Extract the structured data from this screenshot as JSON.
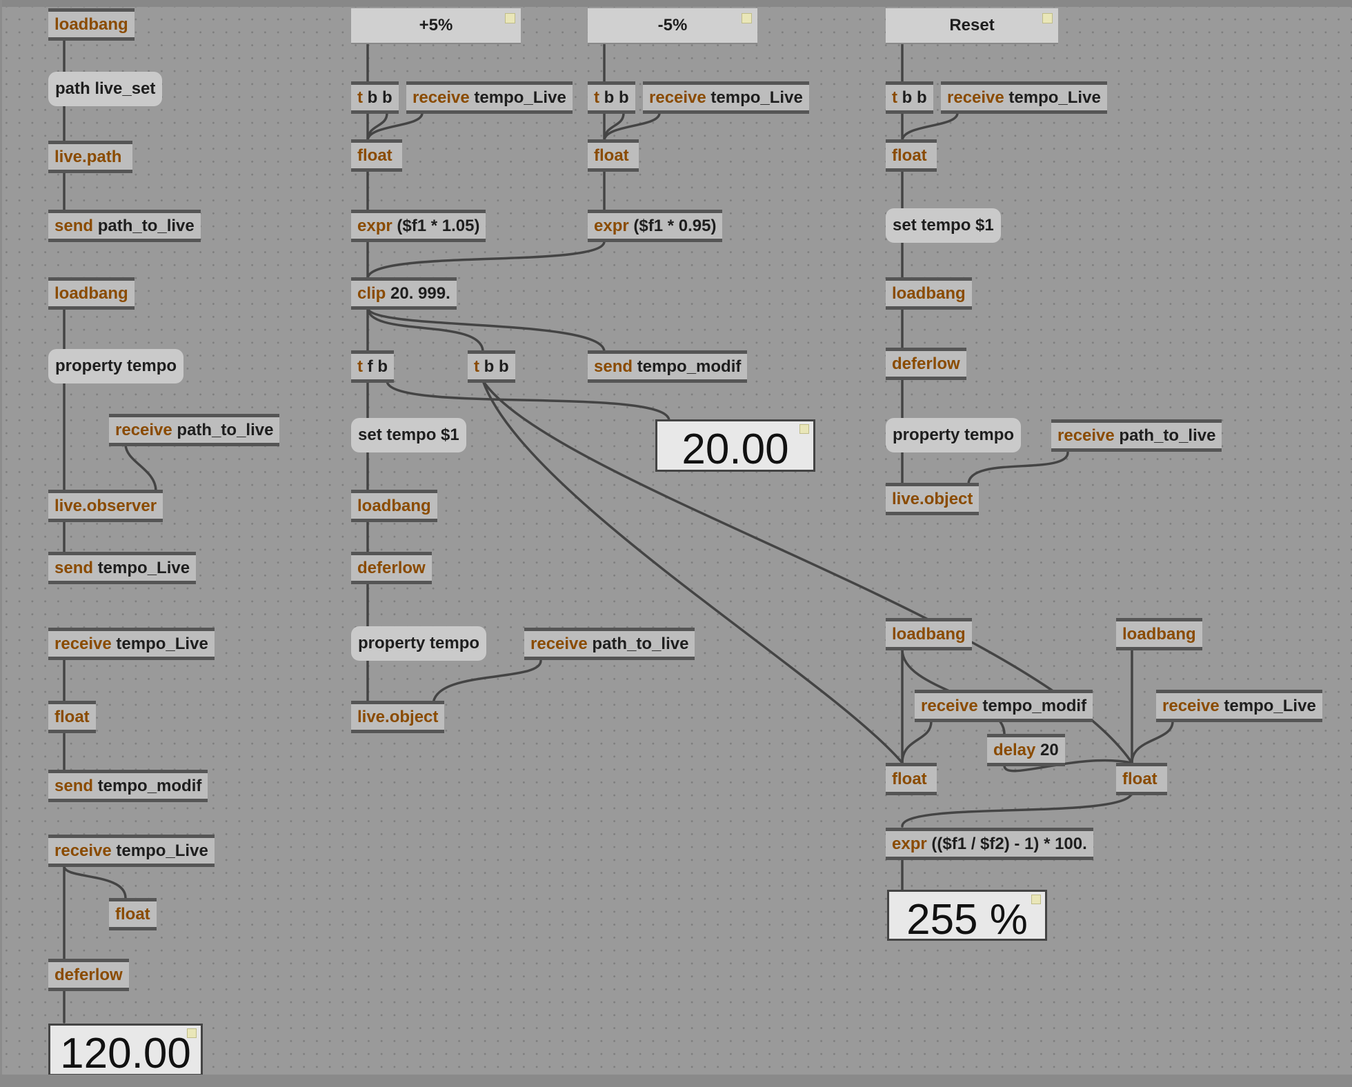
{
  "buttons": {
    "plus": "+5%",
    "minus": "-5%",
    "reset": "Reset"
  },
  "displays": {
    "tempo_mod": "20.00",
    "tempo_main": "120.00",
    "percent": "255 %"
  },
  "messages": {
    "path_live_set": "path live_set",
    "property_tempo_a": "property tempo",
    "set_tempo_mid": "set tempo $1",
    "property_tempo_mid": "property tempo",
    "set_tempo_right": "set tempo $1",
    "property_tempo_right": "property tempo"
  },
  "objects": {
    "loadbang_1": {
      "cls": "loadbang",
      "args": ""
    },
    "live_path": {
      "cls": "live.path",
      "args": ""
    },
    "send_path": {
      "cls": "send",
      "args": "path_to_live"
    },
    "loadbang_2": {
      "cls": "loadbang",
      "args": ""
    },
    "recv_path_left": {
      "cls": "receive",
      "args": "path_to_live"
    },
    "live_observer": {
      "cls": "live.observer",
      "args": ""
    },
    "send_tempo_live": {
      "cls": "send",
      "args": "tempo_Live"
    },
    "recv_tempo_live_a": {
      "cls": "receive",
      "args": "tempo_Live"
    },
    "float_left_a": {
      "cls": "float",
      "args": ""
    },
    "send_tempo_modif_left": {
      "cls": "send",
      "args": "tempo_modif"
    },
    "recv_tempo_live_b": {
      "cls": "receive",
      "args": "tempo_Live"
    },
    "float_left_b": {
      "cls": "float",
      "args": ""
    },
    "deferlow_left": {
      "cls": "deferlow",
      "args": ""
    },
    "tbb_plus": {
      "cls": "t",
      "args": "b b"
    },
    "recv_tempo_plus": {
      "cls": "receive",
      "args": "tempo_Live"
    },
    "float_plus": {
      "cls": "float",
      "args": ""
    },
    "expr_plus": {
      "cls": "expr",
      "args": "($f1 * 1.05)"
    },
    "tbb_minus": {
      "cls": "t",
      "args": "b b"
    },
    "recv_tempo_minus": {
      "cls": "receive",
      "args": "tempo_Live"
    },
    "float_minus": {
      "cls": "float",
      "args": ""
    },
    "expr_minus": {
      "cls": "expr",
      "args": "($f1 * 0.95)"
    },
    "clip": {
      "cls": "clip",
      "args": "20. 999."
    },
    "tfb": {
      "cls": "t",
      "args": "f b"
    },
    "tbb_mid": {
      "cls": "t",
      "args": "b b"
    },
    "send_tempo_modif_mid": {
      "cls": "send",
      "args": "tempo_modif"
    },
    "loadbang_mid": {
      "cls": "loadbang",
      "args": ""
    },
    "deferlow_mid": {
      "cls": "deferlow",
      "args": ""
    },
    "recv_path_mid": {
      "cls": "receive",
      "args": "path_to_live"
    },
    "live_object_mid": {
      "cls": "live.object",
      "args": ""
    },
    "tbb_reset": {
      "cls": "t",
      "args": "b b"
    },
    "recv_tempo_reset": {
      "cls": "receive",
      "args": "tempo_Live"
    },
    "float_reset": {
      "cls": "float",
      "args": ""
    },
    "loadbang_right": {
      "cls": "loadbang",
      "args": ""
    },
    "deferlow_right": {
      "cls": "deferlow",
      "args": ""
    },
    "recv_path_right": {
      "cls": "receive",
      "args": "path_to_live"
    },
    "live_object_right": {
      "cls": "live.object",
      "args": ""
    },
    "loadbang_pct_a": {
      "cls": "loadbang",
      "args": ""
    },
    "loadbang_pct_b": {
      "cls": "loadbang",
      "args": ""
    },
    "recv_tempo_modif_pct": {
      "cls": "receive",
      "args": "tempo_modif"
    },
    "recv_tempo_live_pct": {
      "cls": "receive",
      "args": "tempo_Live"
    },
    "delay": {
      "cls": "delay",
      "args": "20"
    },
    "float_pct_a": {
      "cls": "float",
      "args": ""
    },
    "float_pct_b": {
      "cls": "float",
      "args": ""
    },
    "expr_pct": {
      "cls": "expr",
      "args": "(($f1 / $f2) - 1) * 100."
    }
  },
  "colors": {
    "canvas": "#9a9a9a",
    "object_box": "#bdbdbd",
    "object_border": "#555555",
    "class_text": "#8a4b00",
    "patch_cord": "#444444"
  }
}
